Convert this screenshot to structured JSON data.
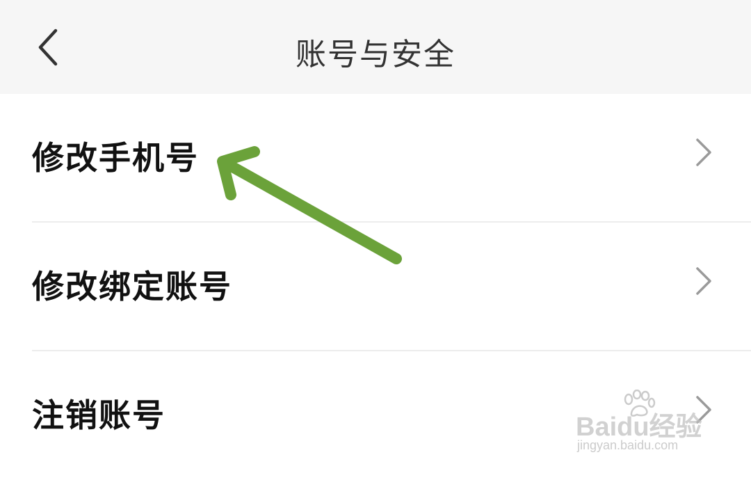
{
  "header": {
    "title": "账号与安全"
  },
  "menu": {
    "items": [
      {
        "label": "修改手机号"
      },
      {
        "label": "修改绑定账号"
      },
      {
        "label": "注销账号"
      }
    ]
  },
  "watermark": {
    "main": "Baidu经验",
    "sub": "jingyan.baidu.com"
  },
  "colors": {
    "header_bg": "#f6f6f6",
    "annotation_arrow": "#6ba23a",
    "chevron": "#9a9a9a"
  }
}
